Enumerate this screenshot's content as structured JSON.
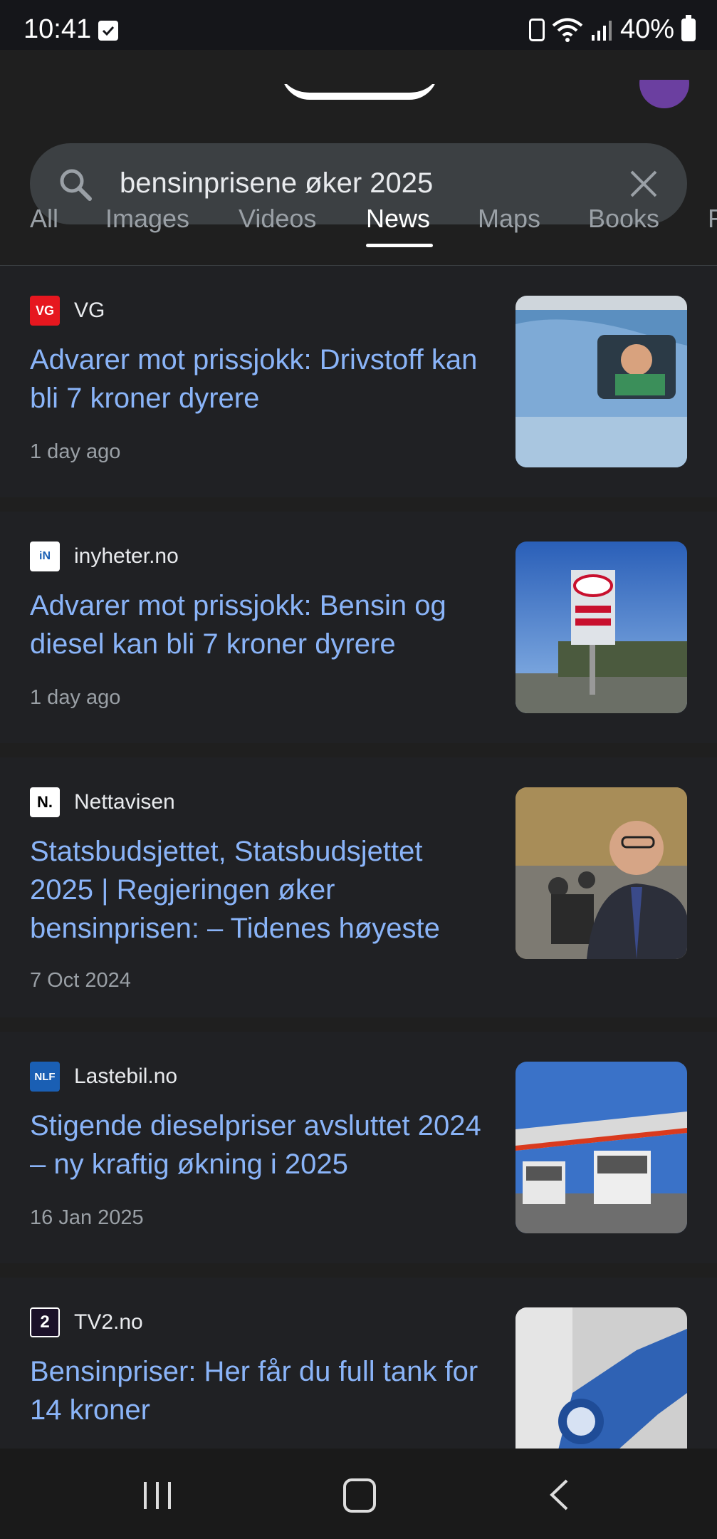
{
  "status_bar": {
    "time": "10:41",
    "battery": "40%"
  },
  "search": {
    "query": "bensinprisene øker 2025"
  },
  "tabs": [
    {
      "label": "All"
    },
    {
      "label": "Images"
    },
    {
      "label": "Videos"
    },
    {
      "label": "News",
      "active": true
    },
    {
      "label": "Maps"
    },
    {
      "label": "Books"
    },
    {
      "label": "F"
    }
  ],
  "results": [
    {
      "source": "VG",
      "headline": "Advarer mot prissjokk: Drivstoff kan bli 7 kroner dyrere",
      "date": "1 day ago",
      "favicon_text": "VG",
      "favicon_color": "#e6171f",
      "thumb_icon": "man-in-car-image"
    },
    {
      "source": "inyheter.no",
      "headline": "Advarer mot prissjokk: Bensin og diesel kan bli 7 kroner dyrere",
      "date": "1 day ago",
      "favicon_text": "iN",
      "favicon_color": "#ffffff",
      "thumb_icon": "esso-sign-image"
    },
    {
      "source": "Nettavisen",
      "headline": "Statsbudsjettet, Statsbudsjettet 2025 | Regjeringen øker bensinprisen: – Tidenes høyeste",
      "date": "7 Oct 2024",
      "favicon_text": "N.",
      "favicon_color": "#ffffff",
      "thumb_icon": "man-in-hall-image"
    },
    {
      "source": "Lastebil.no",
      "headline": "Stigende dieselpriser avsluttet 2024 – ny kraftig økning i 2025",
      "date": "16 Jan 2025",
      "favicon_text": "NLF",
      "favicon_color": "#1a5fb4",
      "thumb_icon": "trucks-at-station-image"
    },
    {
      "source": "TV2.no",
      "headline": "Bensinpriser: Her får du full tank for 14 kroner",
      "date": "",
      "favicon_text": "2",
      "favicon_color": "#1b1029",
      "thumb_icon": "fuel-nozzle-image"
    }
  ]
}
